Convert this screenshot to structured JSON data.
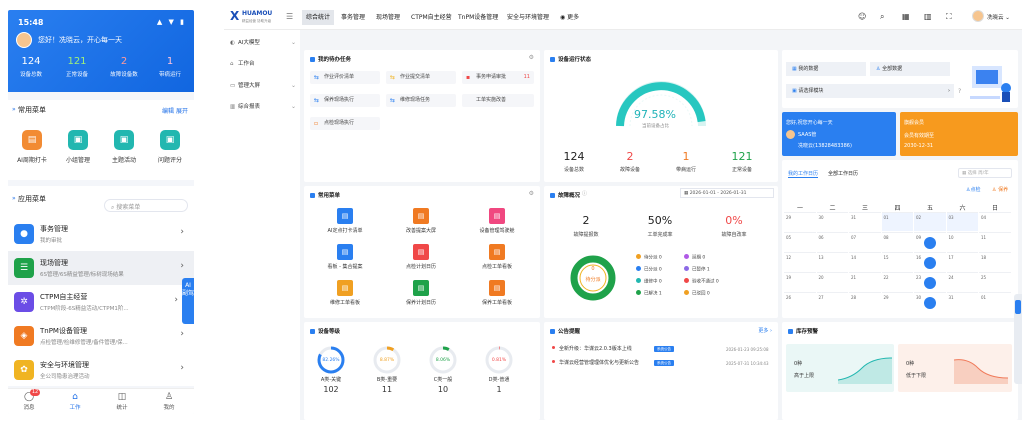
{
  "phone": {
    "time": "15:48",
    "signal": "▲ ▼ ▮",
    "greeting": "您好！冼晓云，开心每一天",
    "stats": [
      {
        "value": "124",
        "label": "设备总数",
        "color": "#ffffff"
      },
      {
        "value": "121",
        "label": "正常设备",
        "color": "#9ff07a"
      },
      {
        "value": "2",
        "label": "故障设备数",
        "color": "#ff9a9a"
      },
      {
        "value": "1",
        "label": "带病运行",
        "color": "#ffc3dc"
      }
    ],
    "common_title": "常用菜单",
    "edit": "编辑",
    "expand": "展开",
    "quick": [
      {
        "label": "AI周期打卡",
        "icon": "clipboard-icon",
        "glyph": "▤",
        "color": "#f28b33"
      },
      {
        "label": "小组管理",
        "icon": "group-icon",
        "glyph": "▣",
        "color": "#22b7b0"
      },
      {
        "label": "主题活动",
        "icon": "activity-icon",
        "glyph": "▣",
        "color": "#22b7b0"
      },
      {
        "label": "问题评分",
        "icon": "score-icon",
        "glyph": "▣",
        "color": "#22b7b0"
      }
    ],
    "apps_title": "应用菜单",
    "search_placeholder": "搜索菜单",
    "apps": [
      {
        "name": "事务管理",
        "desc": "我的审批",
        "icon": "user-icon",
        "glyph": "●",
        "color": "#2a7ff0"
      },
      {
        "name": "现场管理",
        "desc": "6S管理/6S精益管理/标树现场结果",
        "icon": "list-icon",
        "glyph": "☰",
        "color": "#1fa24a"
      },
      {
        "name": "CTPM自主经营",
        "desc": "CTPM阶段-6S精益活动/CTPM1阶...",
        "icon": "gear-icon",
        "glyph": "✲",
        "color": "#6b4de6"
      },
      {
        "name": "TnPM设备管理",
        "desc": "点检管理/检维修管理/备件管理/保...",
        "icon": "device-icon",
        "glyph": "◈",
        "color": "#f07a22"
      },
      {
        "name": "安全与环境管理",
        "desc": "全公司隐患治理活动",
        "icon": "leaf-icon",
        "glyph": "✿",
        "color": "#f0b422"
      }
    ],
    "ai_badge": "AI 副驾",
    "tabs": [
      {
        "label": "消息",
        "glyph": "◯",
        "icon": "message-icon"
      },
      {
        "label": "工作",
        "glyph": "⌂",
        "icon": "home-icon"
      },
      {
        "label": "统计",
        "glyph": "◫",
        "icon": "chart-icon"
      },
      {
        "label": "我的",
        "glyph": "♙",
        "icon": "person-icon"
      }
    ],
    "msg_badge": "12"
  },
  "desktop": {
    "logo_mark": "X",
    "logo_name": "HUAMOU",
    "logo_sub": "精益经营 协助升级",
    "top_menu": [
      "综合统计",
      "事务管理",
      "现场管理",
      "CTPM自主经营",
      "TnPM设备管理",
      "安全与环境管理",
      "更多"
    ],
    "top_icons": [
      "☺",
      "⌕",
      "▦",
      "▥",
      "⛶"
    ],
    "user": "冼晓云",
    "sidebar": [
      {
        "label": "AI大模型",
        "icon": "ai-icon",
        "glyph": "◐",
        "arrow": "⌄"
      },
      {
        "label": "工作台",
        "icon": "workbench-icon",
        "glyph": "⌂",
        "arrow": ""
      },
      {
        "label": "管理大屏",
        "icon": "screen-icon",
        "glyph": "▭",
        "arrow": "⌄"
      },
      {
        "label": "综合报表",
        "icon": "report-icon",
        "glyph": "▥",
        "arrow": "⌄"
      }
    ],
    "todo": {
      "title": "我的待办任务",
      "items": [
        {
          "label": "作业评价清单",
          "count": "",
          "color": "#2a7ff0",
          "glyph": "⇆"
        },
        {
          "label": "作业提交清单",
          "count": "",
          "color": "#f0b422",
          "glyph": "⇆"
        },
        {
          "label": "事务申请审批",
          "count": "11",
          "color": "#f04848",
          "glyph": "▪"
        },
        {
          "label": "保养现场执行",
          "count": "",
          "color": "#2a7ff0",
          "glyph": "⇆"
        },
        {
          "label": "维修现场任务",
          "count": "",
          "color": "#2a7ff0",
          "glyph": "⇆"
        },
        {
          "label": "工单实施改善",
          "count": "",
          "color": "#2a7ff0",
          "glyph": ""
        },
        {
          "label": "点检现场执行",
          "count": "",
          "color": "#f07a22",
          "glyph": "▫"
        }
      ]
    },
    "status": {
      "title": "设备运行状态",
      "percent": "97.58%",
      "caption": "当前设备占比",
      "stats": [
        {
          "value": "124",
          "label": "设备总数",
          "color": "#222222"
        },
        {
          "value": "2",
          "label": "故障设备",
          "color": "#f04848"
        },
        {
          "value": "1",
          "label": "带病运行",
          "color": "#f07a22"
        },
        {
          "value": "121",
          "label": "正常设备",
          "color": "#1fa24a"
        }
      ]
    },
    "data_panel": {
      "my_data": "我的数据",
      "all_data": "全部数据",
      "select_module": "请选择模块",
      "banner_text": "您好,祝您开心每一天",
      "company": "SAAS管",
      "user_phone": "冼晓云(13828483386)",
      "member_label": "旗舰会员",
      "member_sub": "会员有效期至",
      "member_date": "2030-12-31"
    },
    "quick": {
      "title": "常用菜单",
      "items": [
        {
          "label": "AI定点打卡清单",
          "color": "#2a7ff0",
          "glyph": "▤"
        },
        {
          "label": "改善提案大屏",
          "color": "#f07a22",
          "glyph": "▤"
        },
        {
          "label": "设备管理驾驶舱",
          "color": "#f04880",
          "glyph": "▤"
        },
        {
          "label": "看板 - 集合提案",
          "color": "#2a7ff0",
          "glyph": "▤"
        },
        {
          "label": "点检计划日历",
          "color": "#f04848",
          "glyph": "▤"
        },
        {
          "label": "点检工单看板",
          "color": "#f07a22",
          "glyph": "▤"
        },
        {
          "label": "维修工单看板",
          "color": "#f0a022",
          "glyph": "▤"
        },
        {
          "label": "保养计划日历",
          "color": "#1fa24a",
          "glyph": "▤"
        },
        {
          "label": "保养工单看板",
          "color": "#f07a22",
          "glyph": "▤"
        }
      ]
    },
    "fault": {
      "title": "故障概况",
      "date_from": "2026-01-01",
      "date_to": "2026-01-31",
      "stats": [
        {
          "value": "2",
          "label": "故障提报数",
          "color": "#222222"
        },
        {
          "value": "50%",
          "label": "工单完成率",
          "color": "#222222"
        },
        {
          "value": "0%",
          "label": "故障自改率",
          "color": "#f04848"
        }
      ],
      "donut_value": "0",
      "donut_label": "待分派",
      "legend": [
        {
          "label": "待分派 0",
          "color": "#f0a022"
        },
        {
          "label": "延期 0",
          "color": "#b05ae6"
        },
        {
          "label": "已分派 0",
          "color": "#2a7ff0"
        },
        {
          "label": "已暂停 1",
          "color": "#8c6ae6"
        },
        {
          "label": "维修中 0",
          "color": "#22b7b0"
        },
        {
          "label": "验收不通过 0",
          "color": "#f04848"
        },
        {
          "label": "已解决 1",
          "color": "#1fa24a"
        },
        {
          "label": "已驳回 0",
          "color": "#f0a022"
        }
      ]
    },
    "calendar": {
      "tab1": "我的工作日历",
      "tab2": "全部工作日历",
      "search_placeholder": "选择 周/年",
      "link1": "点检",
      "link2": "保养",
      "weekdays": [
        "一",
        "二",
        "三",
        "四",
        "五",
        "六",
        "日"
      ],
      "cells": [
        [
          "29",
          "30",
          "31",
          "01",
          "02",
          "03",
          "04"
        ],
        [
          "05",
          "06",
          "07",
          "08",
          "09",
          "10",
          "11"
        ],
        [
          "12",
          "13",
          "14",
          "15",
          "16",
          "17",
          "18"
        ],
        [
          "19",
          "20",
          "21",
          "22",
          "23",
          "24",
          "25"
        ],
        [
          "26",
          "27",
          "28",
          "29",
          "30",
          "31",
          "01"
        ]
      ]
    },
    "equipment": {
      "title": "设备等级",
      "items": [
        {
          "pct": "82.26%",
          "label": "A类-关键",
          "count": "102",
          "color": "#2a7ff0",
          "ratio": 0.8226
        },
        {
          "pct": "8.87%",
          "label": "B类-重要",
          "count": "11",
          "color": "#f0a022",
          "ratio": 0.0887
        },
        {
          "pct": "8.06%",
          "label": "C类一般",
          "count": "10",
          "color": "#1fa24a",
          "ratio": 0.0806
        },
        {
          "pct": "0.81%",
          "label": "D类-普通",
          "count": "1",
          "color": "#f04848",
          "ratio": 0.0081
        }
      ]
    },
    "notice": {
      "title": "公告提醒",
      "more": "更多",
      "items": [
        {
          "text": "全新升级：华谋云2.0.3版本上线",
          "date": "2026-01-23 09:25:08",
          "tag": "系统公告"
        },
        {
          "text": "华谋云经营管理理体优化与更新公告",
          "date": "2025-07-31 10:34:43",
          "tag": "系统公告"
        }
      ]
    },
    "stock": {
      "title": "库存预警",
      "box1_value": "0种",
      "box1_label": "高于上限",
      "box2_value": "0种",
      "box2_label": "低于下限"
    }
  }
}
